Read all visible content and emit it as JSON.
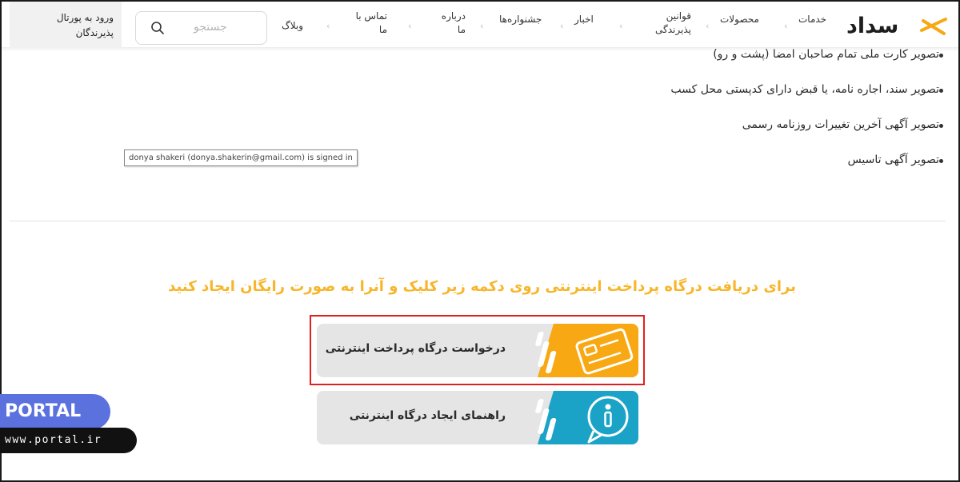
{
  "header": {
    "logo_text": "سداد",
    "nav": [
      {
        "label": "خدمات",
        "chevron": "‹"
      },
      {
        "label": "محصولات",
        "chevron": "‹"
      },
      {
        "label": "قوانین پذیرندگی",
        "chevron": "‹"
      },
      {
        "label": "اخبار",
        "chevron": "‹"
      },
      {
        "label": "جشنواره‌ها",
        "chevron": "‹"
      },
      {
        "label": "درباره ما",
        "chevron": "‹"
      },
      {
        "label": "تماس با ما",
        "chevron": "‹"
      },
      {
        "label": "وبلاگ"
      }
    ],
    "search": {
      "placeholder": "جستجو"
    },
    "portal_login": "ورود به پورتال پذیرندگان"
  },
  "documents": {
    "items": [
      "تصویر کارت ملی تمام صاحبان امضا (پشت و رو)",
      "تصویر سند، اجاره نامه، یا قبض دارای کدپستی محل کسب",
      "تصویر آگهی آخرین تغییرات روزنامه رسمی",
      "تصویر آگهی تاسیس"
    ]
  },
  "tooltip": "donya shakeri (donya.shakerin@gmail.com) is signed in",
  "cta": {
    "headline": "برای دریافت درگاه پرداخت اینترنتی  روی دکمه زیر کلیک  و آنرا به صورت رایگان ایجاد کنید",
    "request_button": "درخواست درگاه پرداخت اینترنتی",
    "guide_button": "راهنمای ایجاد درگاه اینترنتی"
  },
  "watermark": {
    "brand": "PORTAL",
    "url": "www.portal.ir"
  },
  "colors": {
    "accent_orange": "#f7a812",
    "headline_yellow": "#f7b52a",
    "teal": "#1aa3c6",
    "highlight_red": "#e02020",
    "watermark_blue": "#5a71de"
  }
}
